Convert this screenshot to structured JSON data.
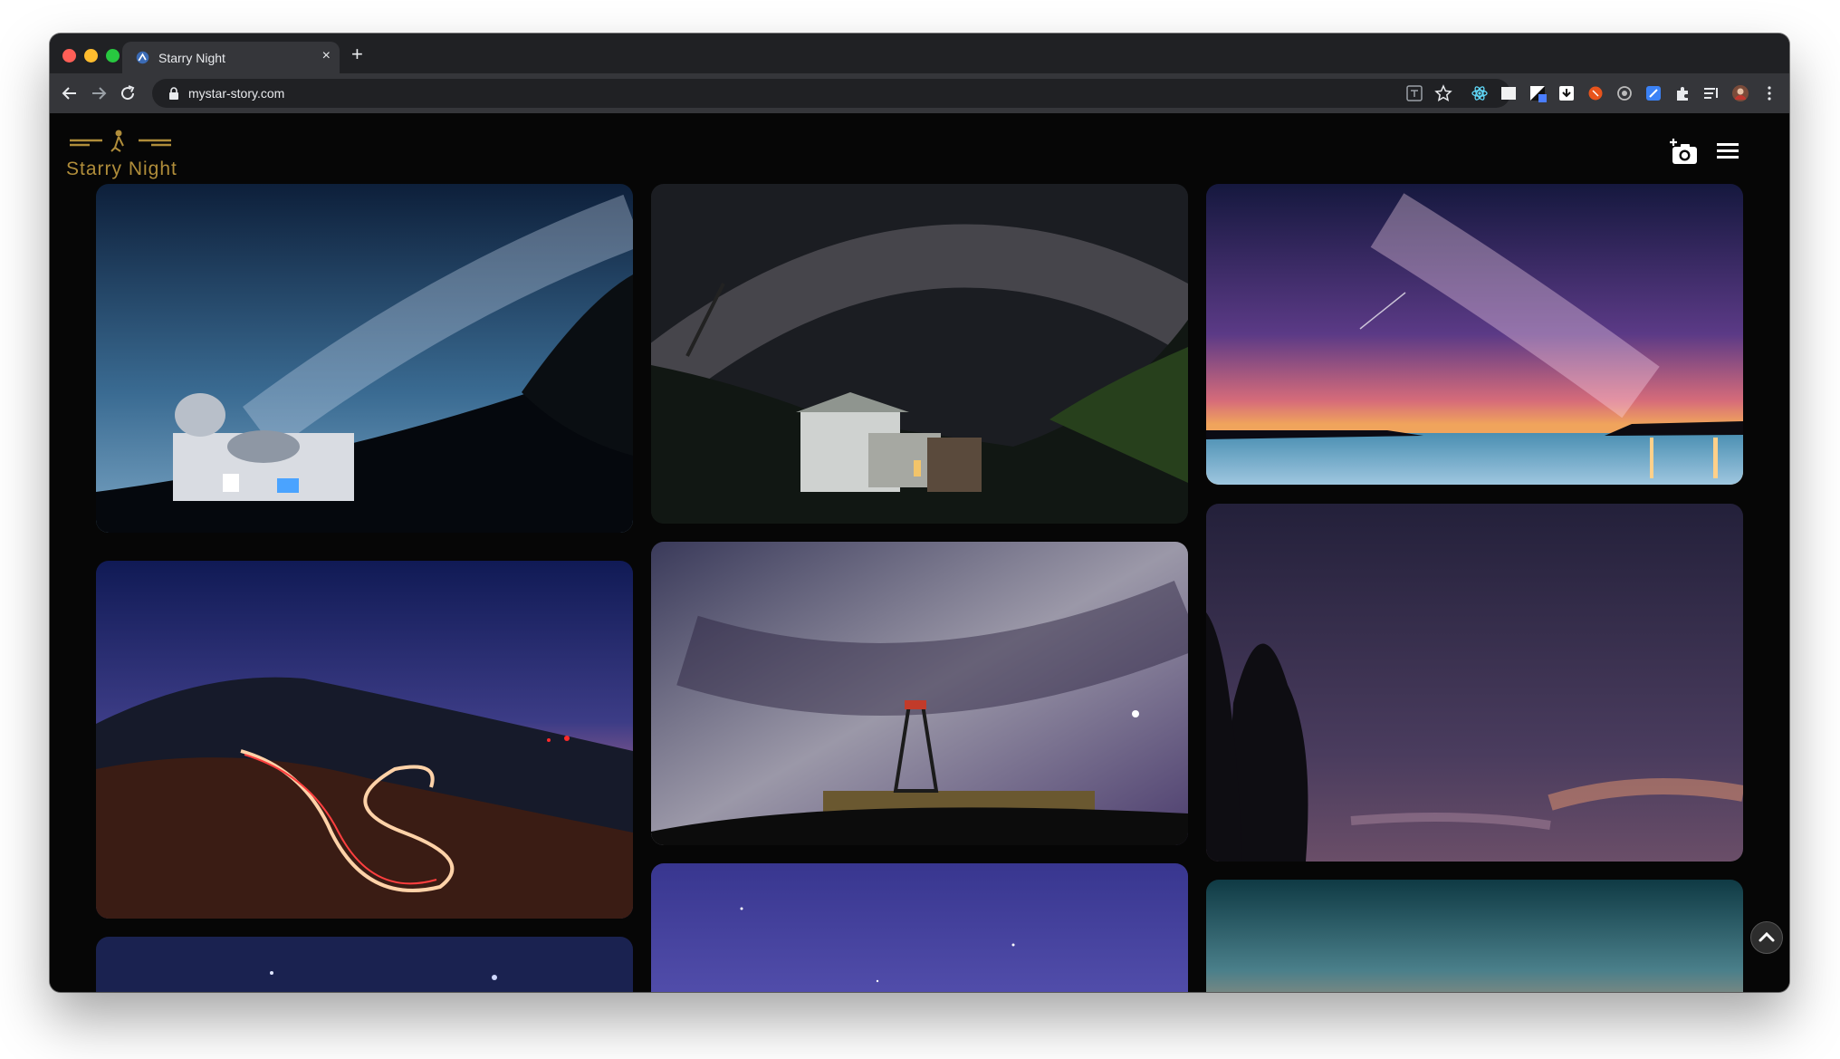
{
  "browser": {
    "tab_title": "Starry Night",
    "new_tab_symbol": "+",
    "close_symbol": "×",
    "url": "mystar-story.com",
    "toolbar_icons": [
      "translate-icon",
      "bookmark-star-icon",
      "react-devtools-icon",
      "extension-square-icon",
      "extension-diagonal-icon",
      "extension-download-icon",
      "extension-orange-icon",
      "extension-circle-icon",
      "extension-blue-icon",
      "extensions-puzzle-icon",
      "reading-list-icon",
      "profile-avatar-icon",
      "more-menu-icon"
    ]
  },
  "site": {
    "logo_text": "Starry Night",
    "accent_color": "#b08d3a",
    "upload_icon": "add-photo-icon",
    "menu_icon": "hamburger-menu-icon",
    "scroll_top_icon": "chevron-up-icon"
  },
  "gallery": {
    "photos": [
      "observatory-milky-way-photo",
      "house-milky-way-arc-photo",
      "lake-sunset-milky-way-photo",
      "mountain-road-light-trails-photo",
      "tower-milky-way-photo",
      "tree-silhouette-night-sky-photo",
      "blue-starry-sky-photo-left",
      "blue-starry-sky-photo-center",
      "teal-dusk-sky-photo"
    ]
  }
}
